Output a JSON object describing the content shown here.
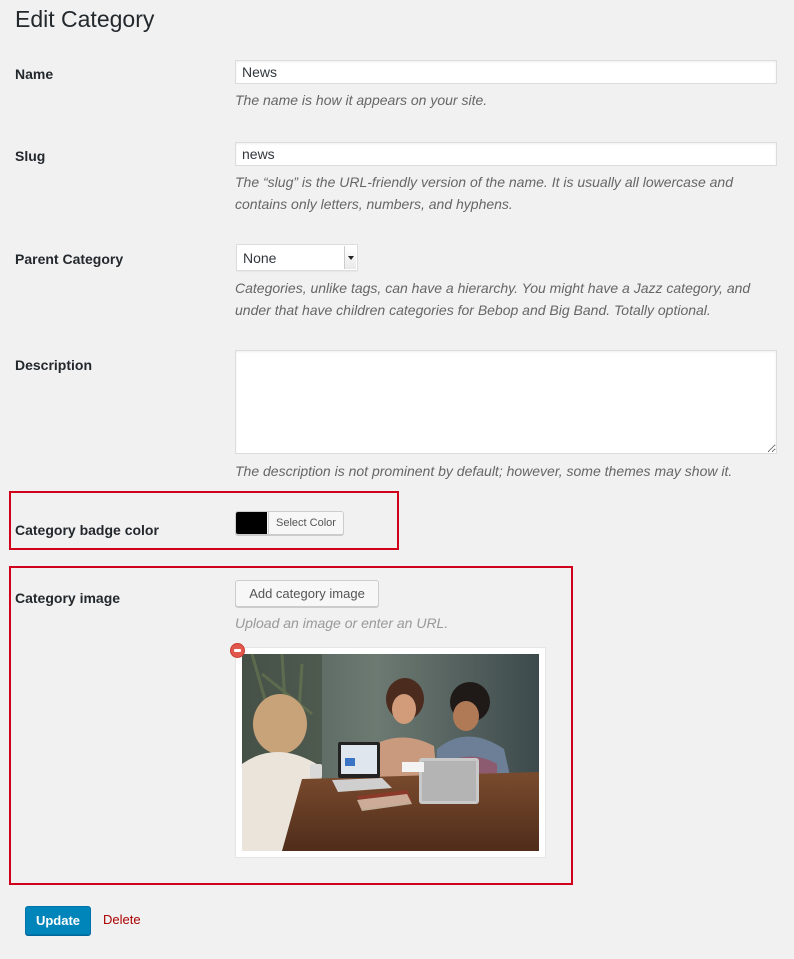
{
  "page": {
    "title": "Edit Category"
  },
  "fields": {
    "name": {
      "label": "Name",
      "value": "News",
      "description": "The name is how it appears on your site."
    },
    "slug": {
      "label": "Slug",
      "value": "news",
      "description_line1": "The “slug” is the URL-friendly version of the name. It is usually all lowercase and",
      "description_line2": "contains only letters, numbers, and hyphens."
    },
    "parent": {
      "label": "Parent Category",
      "selected": "None",
      "description_line1": "Categories, unlike tags, can have a hierarchy. You might have a Jazz category, and",
      "description_line2": "under that have children categories for Bebop and Big Band. Totally optional."
    },
    "description": {
      "label": "Description",
      "value": "",
      "help": "The description is not prominent by default; however, some themes may show it."
    },
    "badge_color": {
      "label": "Category badge color",
      "color": "#000000",
      "button_label": "Select Color"
    },
    "image": {
      "label": "Category image",
      "button_label": "Add category image",
      "help": "Upload an image or enter an URL."
    }
  },
  "actions": {
    "update_label": "Update",
    "delete_label": "Delete"
  },
  "colors": {
    "highlight": "#d0021b",
    "primary": "#0085ba",
    "delete": "#aa0000"
  }
}
